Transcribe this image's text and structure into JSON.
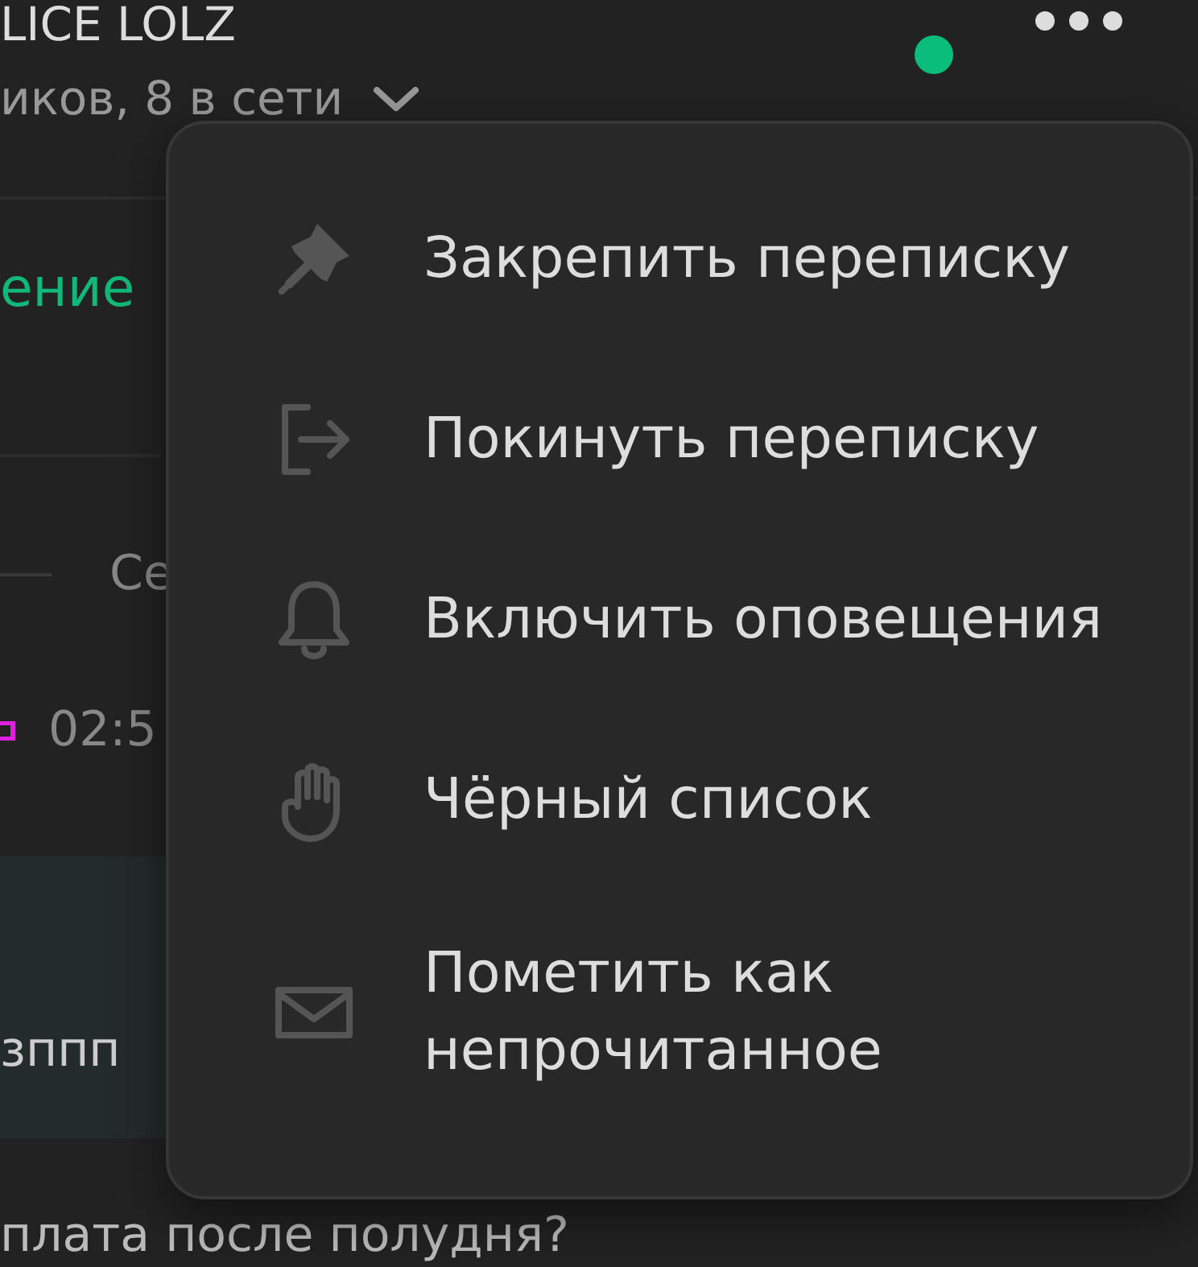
{
  "header": {
    "title": "LICE LOLZ",
    "subtitle": "иков, 8 в сети",
    "online": true
  },
  "chat": {
    "link_text": "ение",
    "date_divider": "Се",
    "message": {
      "time": "02:5",
      "text": "зппп"
    },
    "next_message": "плата после полудня?"
  },
  "menu": {
    "items": [
      {
        "label": "Закрепить переписку"
      },
      {
        "label": "Покинуть переписку"
      },
      {
        "label": "Включить оповещения"
      },
      {
        "label": "Чёрный список"
      },
      {
        "label": "Пометить как непрочитанное"
      }
    ]
  }
}
